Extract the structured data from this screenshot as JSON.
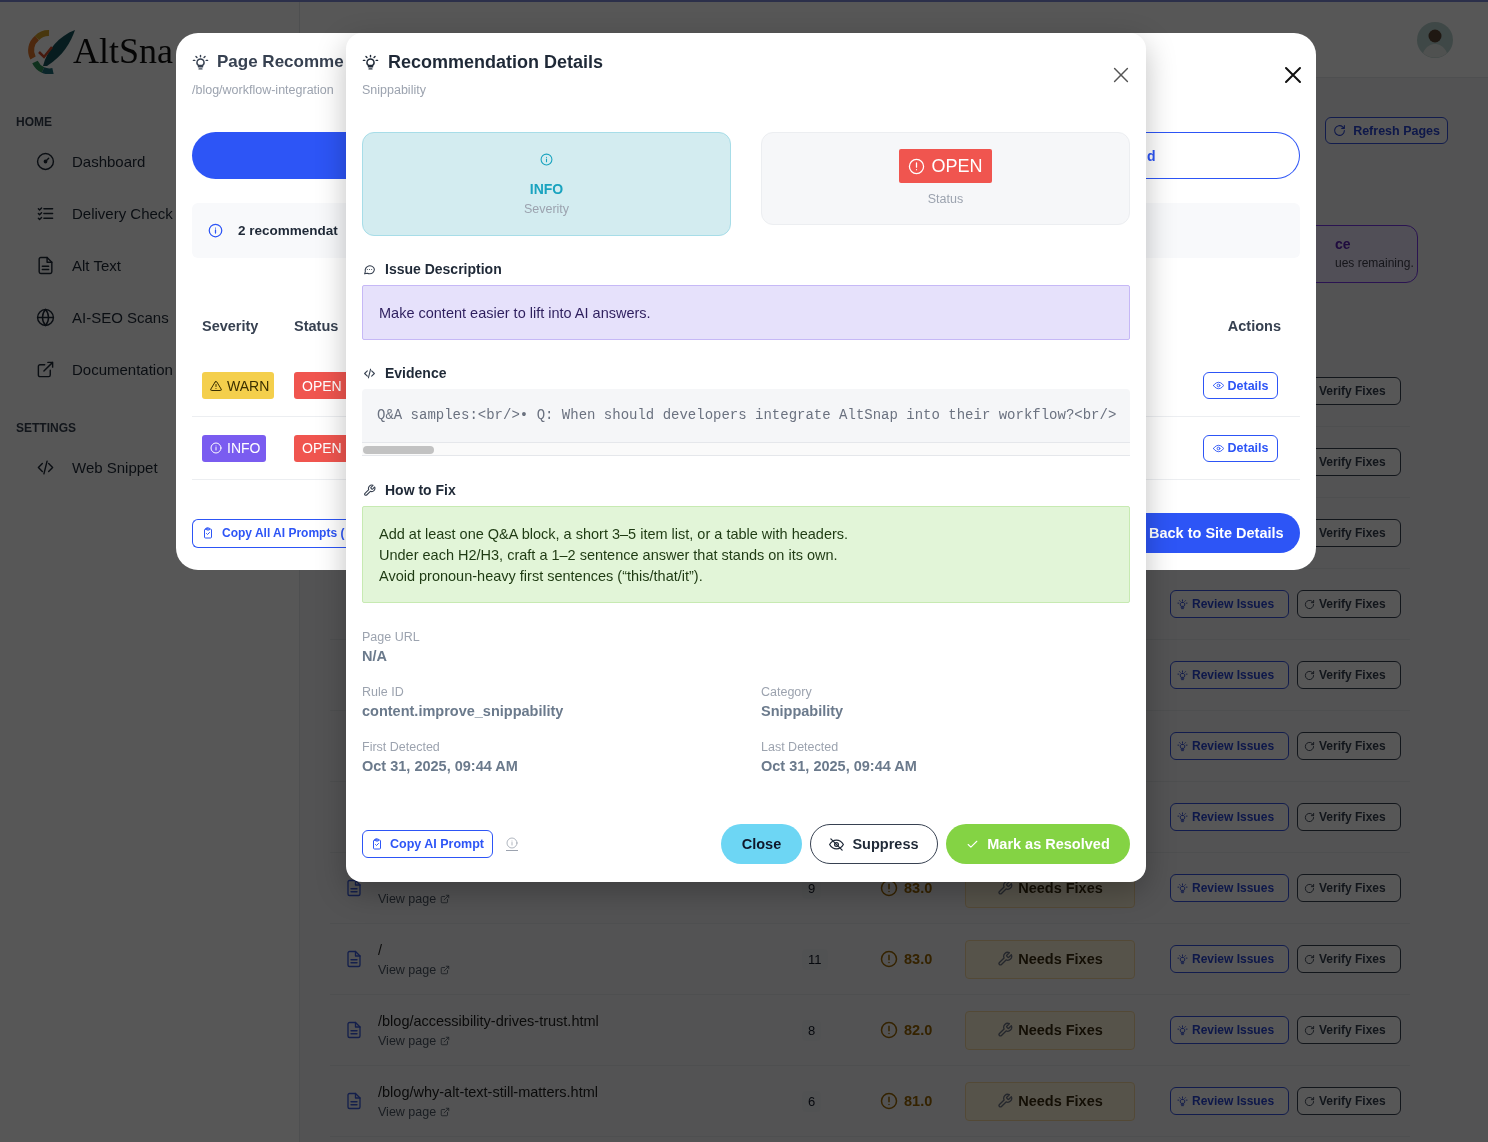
{
  "sidebar": {
    "logo_text": "AltSna",
    "sections": [
      {
        "heading": "HOME",
        "items": [
          {
            "label": "Dashboard"
          },
          {
            "label": "Delivery Check"
          },
          {
            "label": "Alt Text"
          },
          {
            "label": "AI-SEO Scans"
          },
          {
            "label": "Documentation"
          }
        ]
      },
      {
        "heading": "SETTINGS",
        "items": [
          {
            "label": "Web Snippet"
          }
        ]
      }
    ]
  },
  "toolbar": {
    "refresh_button": "Refresh Pages"
  },
  "summary_card": {
    "title": "ce",
    "subtitle": "ues remaining."
  },
  "pages_table": {
    "rows": [
      {
        "verify_button": "Verify Fixes"
      },
      {
        "verify_button": "Verify Fixes"
      },
      {
        "verify_button": "Verify Fixes"
      },
      {
        "review_button": "Review Issues",
        "verify_button": "Verify Fixes"
      },
      {
        "review_button": "Review Issues",
        "verify_button": "Verify Fixes"
      },
      {
        "review_button": "Review Issues",
        "verify_button": "Verify Fixes"
      },
      {
        "review_button": "Review Issues",
        "verify_button": "Verify Fixes"
      },
      {
        "view_link": "View page",
        "issues": "9",
        "score": "83.0",
        "status": "Needs Fixes",
        "review_button": "Review Issues",
        "verify_button": "Verify Fixes"
      },
      {
        "path": "/",
        "view_link": "View page",
        "issues": "11",
        "score": "83.0",
        "status": "Needs Fixes",
        "review_button": "Review Issues",
        "verify_button": "Verify Fixes"
      },
      {
        "path": "/blog/accessibility-drives-trust.html",
        "view_link": "View page",
        "issues": "8",
        "score": "82.0",
        "status": "Needs Fixes",
        "review_button": "Review Issues",
        "verify_button": "Verify Fixes"
      },
      {
        "path": "/blog/why-alt-text-still-matters.html",
        "view_link": "View page",
        "issues": "6",
        "score": "81.0",
        "status": "Needs Fixes",
        "review_button": "Review Issues",
        "verify_button": "Verify Fixes"
      }
    ]
  },
  "recommendations_modal": {
    "title": "Page Recomme",
    "subtitle": "/blog/workflow-integration",
    "outline_button": "d",
    "info_text": "2 recommendat",
    "columns": [
      {
        "label": "Severity"
      },
      {
        "label": "Status"
      },
      {
        "label": "Actions"
      }
    ],
    "rows": [
      {
        "severity": {
          "label": "WARN",
          "kind": "warn"
        },
        "status": {
          "label": "OPEN",
          "kind": "open"
        },
        "details_button": "Details"
      },
      {
        "severity": {
          "label": "INFO",
          "kind": "info"
        },
        "status": {
          "label": "OPEN",
          "kind": "open"
        },
        "details_button": "Details"
      }
    ],
    "copy_button": "Copy All AI Prompts (",
    "back_button": "Back to Site Details"
  },
  "details_modal": {
    "title": "Recommendation Details",
    "subtitle": "Snippability",
    "severity": {
      "label": "INFO",
      "kind": "info",
      "caption": "Severity"
    },
    "status": {
      "label": "OPEN",
      "kind": "open",
      "caption": "Status"
    },
    "issue_description": {
      "heading": "Issue Description",
      "text": "Make content easier to lift into AI answers."
    },
    "evidence": {
      "heading": "Evidence",
      "code": "Q&A samples:<br/>• Q: When should developers integrate AltSnap into their workflow?<br/>"
    },
    "how_to_fix": {
      "heading": "How to Fix",
      "lines": [
        "Add at least one Q&A block, a short 3–5 item list, or a table with headers.",
        "Under each H2/H3, craft a 1–2 sentence answer that stands on its own.",
        "Avoid pronoun-heavy first sentences (“this/that/it”)."
      ]
    },
    "page_url": {
      "label": "Page URL",
      "value": "N/A"
    },
    "fields": [
      {
        "label": "Rule ID",
        "value": "content.improve_snippability"
      },
      {
        "label": "Category",
        "value": "Snippability"
      },
      {
        "label": "First Detected",
        "value": "Oct 31, 2025, 09:44 AM"
      },
      {
        "label": "Last Detected",
        "value": "Oct 31, 2025, 09:44 AM"
      }
    ],
    "copy_prompt_button": "Copy AI Prompt",
    "close_button": "Close",
    "suppress_button": "Suppress",
    "resolve_button": "Mark as Resolved"
  }
}
